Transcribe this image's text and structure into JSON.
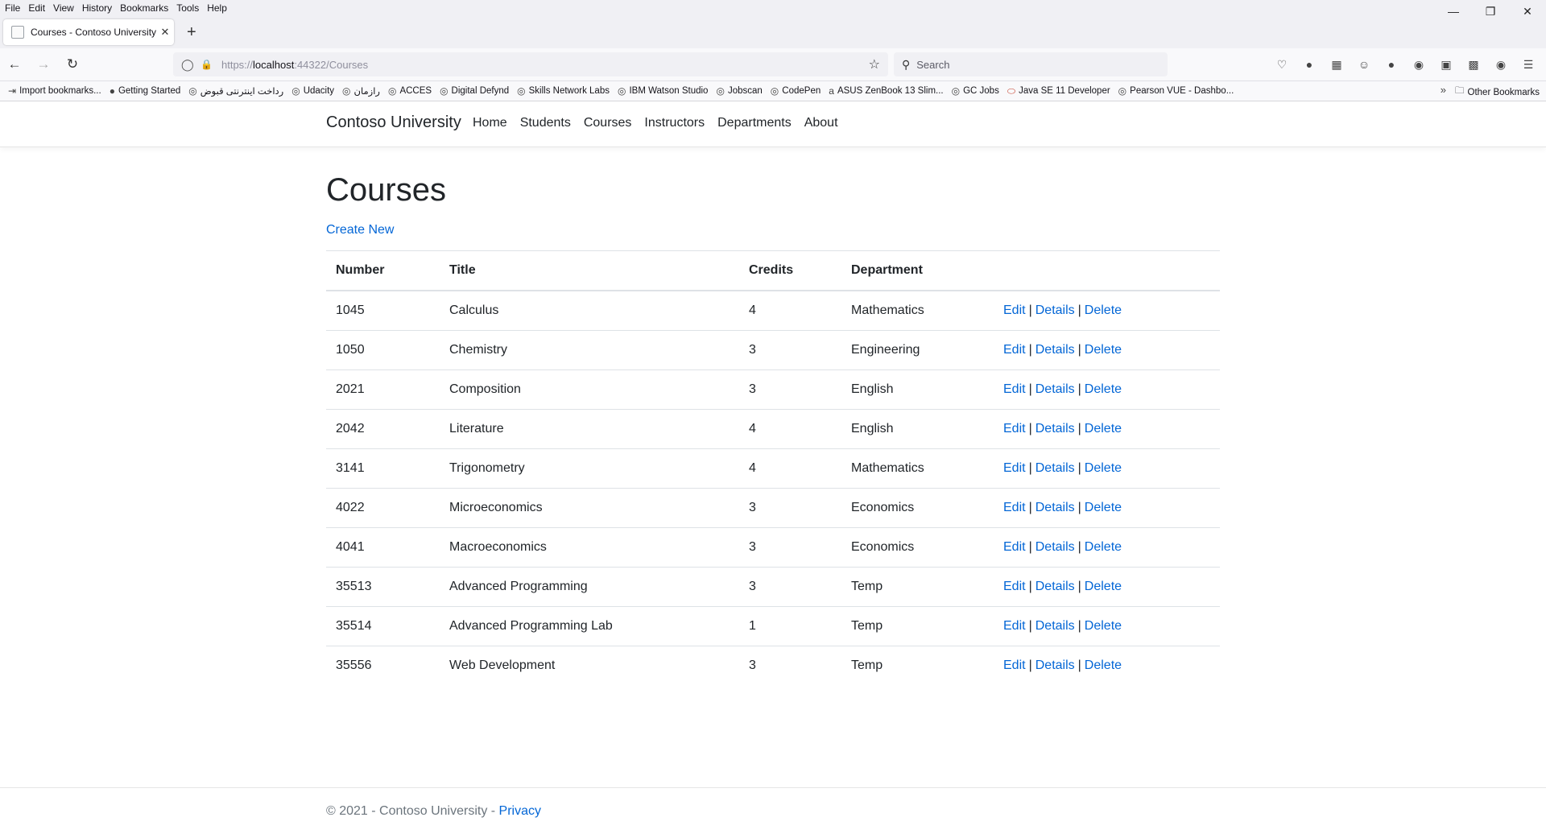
{
  "browser": {
    "menu": [
      "File",
      "Edit",
      "View",
      "History",
      "Bookmarks",
      "Tools",
      "Help"
    ],
    "tab_title": "Courses - Contoso University",
    "url_prefix": "https://",
    "url_host": "localhost",
    "url_rest": ":44322/Courses",
    "search_placeholder": "Search",
    "bookmarks": [
      "Import bookmarks...",
      "Getting Started",
      "رداخت اینترنتی قبوض",
      "Udacity",
      "رازمان",
      "ACCES",
      "Digital Defynd",
      "Skills Network Labs",
      "IBM Watson Studio",
      "Jobscan",
      "CodePen",
      "ASUS ZenBook 13 Slim...",
      "GC Jobs",
      "Java SE 11 Developer",
      "Pearson VUE - Dashbo..."
    ],
    "other_bookmarks": "Other Bookmarks"
  },
  "site": {
    "brand": "Contoso University",
    "nav": [
      "Home",
      "Students",
      "Courses",
      "Instructors",
      "Departments",
      "About"
    ]
  },
  "page": {
    "title": "Courses",
    "create_new": "Create New",
    "columns": [
      "Number",
      "Title",
      "Credits",
      "Department"
    ],
    "actions": [
      "Edit",
      "Details",
      "Delete"
    ],
    "rows": [
      {
        "number": "1045",
        "title": "Calculus",
        "credits": "4",
        "department": "Mathematics"
      },
      {
        "number": "1050",
        "title": "Chemistry",
        "credits": "3",
        "department": "Engineering"
      },
      {
        "number": "2021",
        "title": "Composition",
        "credits": "3",
        "department": "English"
      },
      {
        "number": "2042",
        "title": "Literature",
        "credits": "4",
        "department": "English"
      },
      {
        "number": "3141",
        "title": "Trigonometry",
        "credits": "4",
        "department": "Mathematics"
      },
      {
        "number": "4022",
        "title": "Microeconomics",
        "credits": "3",
        "department": "Economics"
      },
      {
        "number": "4041",
        "title": "Macroeconomics",
        "credits": "3",
        "department": "Economics"
      },
      {
        "number": "35513",
        "title": "Advanced Programming",
        "credits": "3",
        "department": "Temp"
      },
      {
        "number": "35514",
        "title": "Advanced Programming Lab",
        "credits": "1",
        "department": "Temp"
      },
      {
        "number": "35556",
        "title": "Web Development",
        "credits": "3",
        "department": "Temp"
      }
    ]
  },
  "footer": {
    "text": "© 2021 - Contoso University - ",
    "privacy": "Privacy"
  },
  "colors": {
    "link": "#0366d6",
    "text": "#212529",
    "muted": "#6c757d"
  }
}
